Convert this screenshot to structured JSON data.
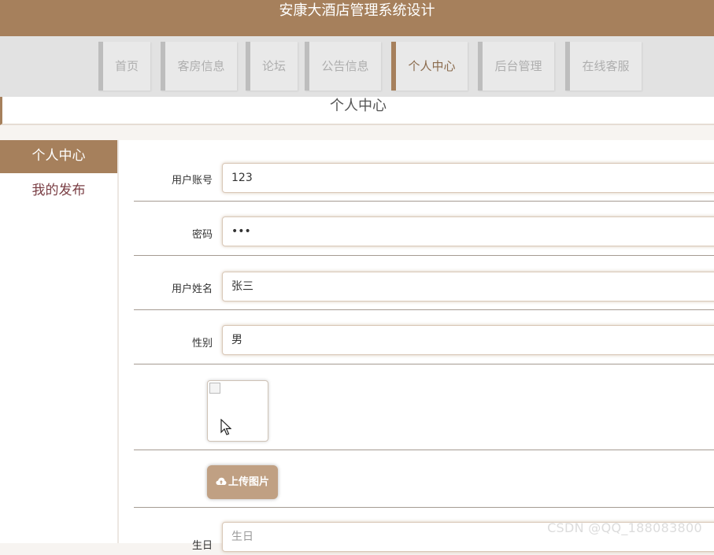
{
  "header": {
    "title": "安康大酒店管理系统设计"
  },
  "nav": {
    "items": [
      {
        "label": "首页"
      },
      {
        "label": "客房信息"
      },
      {
        "label": "论坛"
      },
      {
        "label": "公告信息"
      },
      {
        "label": "个人中心"
      },
      {
        "label": "后台管理"
      },
      {
        "label": "在线客服"
      }
    ],
    "active": "个人中心"
  },
  "page": {
    "title": "个人中心"
  },
  "sidebar": {
    "items": [
      {
        "label": "个人中心"
      },
      {
        "label": "我的发布"
      }
    ]
  },
  "form": {
    "username": {
      "label": "用户账号",
      "value": "123"
    },
    "password": {
      "label": "密码",
      "value": "•••"
    },
    "name": {
      "label": "用户姓名",
      "value": "张三"
    },
    "gender": {
      "label": "性别",
      "value": "男"
    },
    "upload_label": "上传图片",
    "birthday": {
      "label": "生日",
      "placeholder": "生日"
    }
  },
  "watermark": "CSDN @QQ_188083800",
  "colors": {
    "accent": "#a6805c",
    "nav_bg": "#e2e2e2",
    "sidebar_text": "#7a3e44"
  }
}
